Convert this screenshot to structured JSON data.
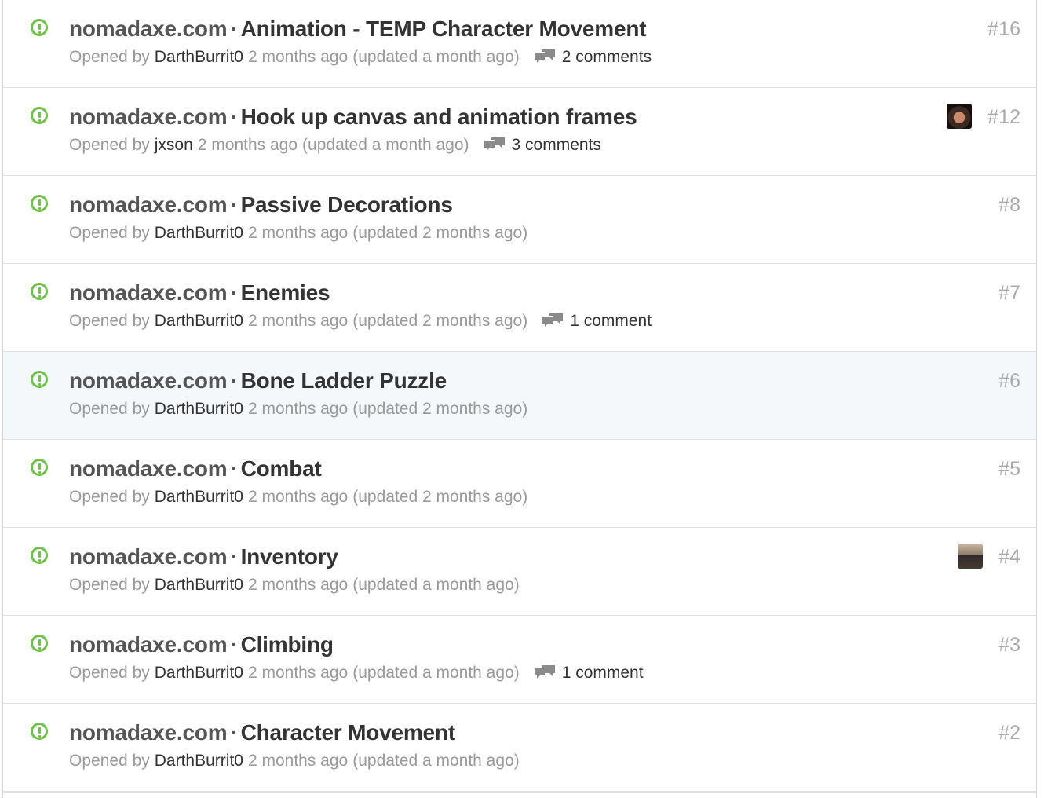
{
  "issues": [
    {
      "repo": "nomadaxe.com",
      "separator": "·",
      "title": "Animation - TEMP Character Movement",
      "opened_label": "Opened by",
      "author": "DarthBurrit0",
      "time": "2 months ago",
      "updated": "(updated a month ago)",
      "comments": "2 comments",
      "number": "#16",
      "avatar": null
    },
    {
      "repo": "nomadaxe.com",
      "separator": "·",
      "title": "Hook up canvas and animation frames",
      "opened_label": "Opened by",
      "author": "jxson",
      "time": "2 months ago",
      "updated": "(updated a month ago)",
      "comments": "3 comments",
      "number": "#12",
      "avatar": "user-avatar"
    },
    {
      "repo": "nomadaxe.com",
      "separator": "·",
      "title": "Passive Decorations",
      "opened_label": "Opened by",
      "author": "DarthBurrit0",
      "time": "2 months ago",
      "updated": "(updated 2 months ago)",
      "comments": null,
      "number": "#8",
      "avatar": null
    },
    {
      "repo": "nomadaxe.com",
      "separator": "·",
      "title": "Enemies",
      "opened_label": "Opened by",
      "author": "DarthBurrit0",
      "time": "2 months ago",
      "updated": "(updated 2 months ago)",
      "comments": "1 comment",
      "number": "#7",
      "avatar": null
    },
    {
      "repo": "nomadaxe.com",
      "separator": "·",
      "title": "Bone Ladder Puzzle",
      "opened_label": "Opened by",
      "author": "DarthBurrit0",
      "time": "2 months ago",
      "updated": "(updated 2 months ago)",
      "comments": null,
      "number": "#6",
      "avatar": null,
      "highlighted": true
    },
    {
      "repo": "nomadaxe.com",
      "separator": "·",
      "title": "Combat",
      "opened_label": "Opened by",
      "author": "DarthBurrit0",
      "time": "2 months ago",
      "updated": "(updated 2 months ago)",
      "comments": null,
      "number": "#5",
      "avatar": null
    },
    {
      "repo": "nomadaxe.com",
      "separator": "·",
      "title": "Inventory",
      "opened_label": "Opened by",
      "author": "DarthBurrit0",
      "time": "2 months ago",
      "updated": "(updated a month ago)",
      "comments": null,
      "number": "#4",
      "avatar": "user-avatar"
    },
    {
      "repo": "nomadaxe.com",
      "separator": "·",
      "title": "Climbing",
      "opened_label": "Opened by",
      "author": "DarthBurrit0",
      "time": "2 months ago",
      "updated": "(updated a month ago)",
      "comments": "1 comment",
      "number": "#3",
      "avatar": null
    },
    {
      "repo": "nomadaxe.com",
      "separator": "·",
      "title": "Character Movement",
      "opened_label": "Opened by",
      "author": "DarthBurrit0",
      "time": "2 months ago",
      "updated": "(updated a month ago)",
      "comments": null,
      "number": "#2",
      "avatar": null
    }
  ],
  "icons": {
    "status": "issue-opened-icon",
    "comments": "comment-discussion-icon"
  },
  "colors": {
    "open_green": "#6cc644",
    "highlight_row": "#f4f8fb",
    "muted_text": "#999999",
    "number_text": "#aaaaaa"
  }
}
